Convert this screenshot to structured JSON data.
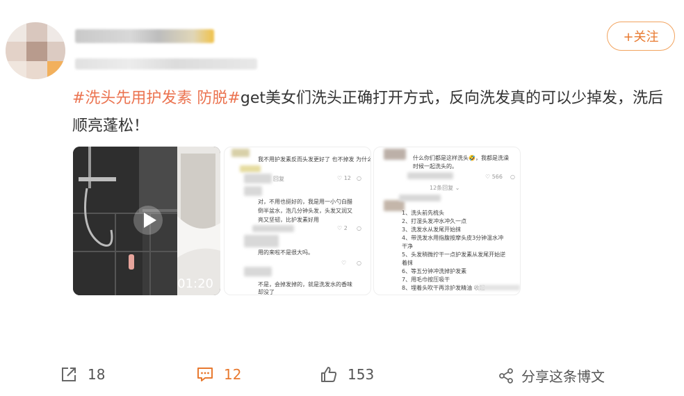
{
  "header": {
    "follow_label": "+关注"
  },
  "post": {
    "tag1": "#洗头先用护发素 防脱#",
    "text": "get美女们洗头正确打开方式，反向洗发真的可以少掉发，洗后顺亮蓬松！"
  },
  "media": {
    "video_duration": "01:20",
    "image2": {
      "c1_text": "我不用护发素反而头发更好了 也不掉发 为什么",
      "c1_reply": "回复",
      "c1_likes": "12",
      "c2_text_1": "对，不用也挺好的，我是用一小勺白醋",
      "c2_text_2": "倒半盆水，泡几分钟头发，头发又润又",
      "c2_text_3": "亮又坚韧，比护发素好用",
      "c2_likes": "2",
      "c3_text": "用的来啦不是很大吗。",
      "c4_text_1": "不是，会掉发掉的，就是洗发水的香味",
      "c4_text_2": "却没了"
    },
    "image3": {
      "c1_text_1": "什么你们都是这样洗头",
      "c1_text_2": "，我都是洗澡",
      "c1_text_3": "时候一起洗头的。",
      "c1_likes": "566",
      "c1_replies": "12条回复",
      "steps": [
        "1、洗头前先梳头",
        "2、打湿头发冲水冲久一点",
        "3、洗发水从发尾开始抹",
        "4、带洗发水用指腹按摩头皮3分钟温水冲",
        "干净",
        "5、头发稍微拧干一点护发素从发尾开始逆",
        "着抹",
        "6、等五分钟冲洗掉护发素",
        "7、用毛巾按压吸干",
        "8、埋着头吹干再涂护发精油"
      ],
      "steps_note": "收起"
    }
  },
  "actions": {
    "share_count": "18",
    "comment_count": "12",
    "like_count": "153",
    "share_post_label": "分享这条博文"
  },
  "colors": {
    "accent": "#eb7350",
    "follow_border": "#f2a35e",
    "comment_active": "#e8792f"
  }
}
